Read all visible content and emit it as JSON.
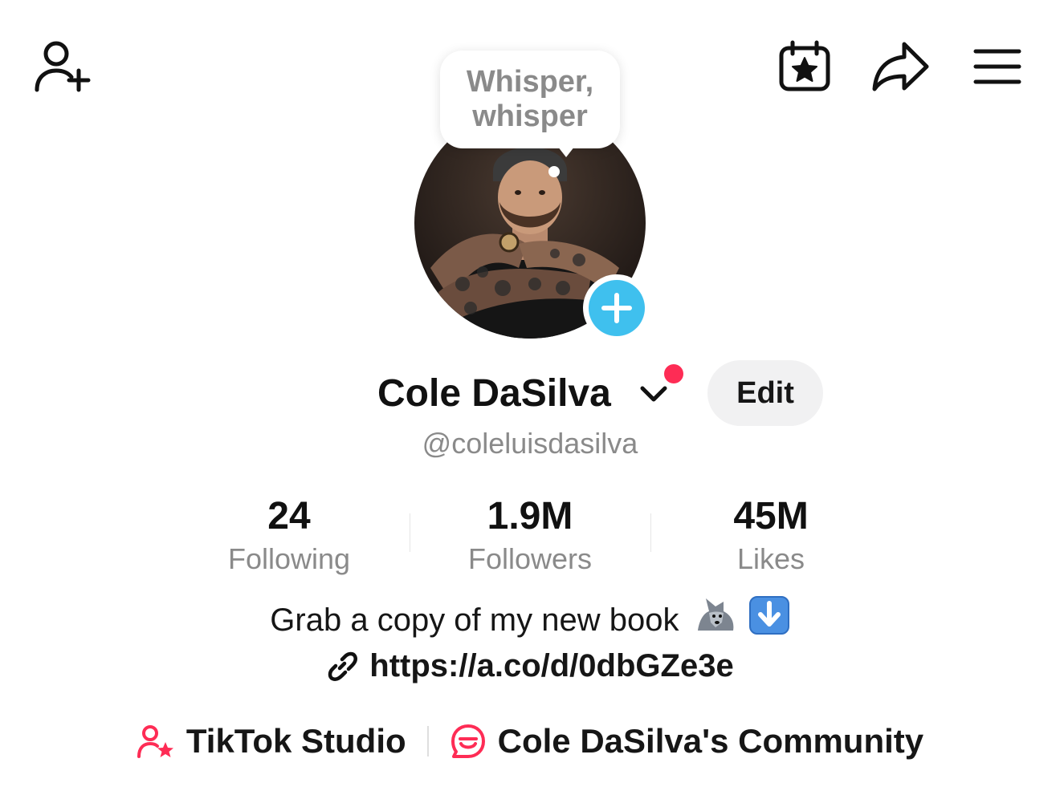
{
  "header": {
    "left_icon": "add-friend-icon",
    "right_icons": [
      "calendar-star-icon",
      "share-arrow-icon",
      "menu-icon"
    ]
  },
  "tooltip": {
    "text": "Whisper, whisper"
  },
  "profile": {
    "name": "Cole DaSilva",
    "handle": "@coleluisdasilva",
    "edit_label": "Edit",
    "accent_color": "#fe2c55",
    "add_color": "#3fc0ee"
  },
  "stats": [
    {
      "value": "24",
      "label": "Following"
    },
    {
      "value": "1.9M",
      "label": "Followers"
    },
    {
      "value": "45M",
      "label": "Likes"
    }
  ],
  "bio": {
    "text": "Grab a copy of my new book",
    "emojis": [
      "wolf-emoji",
      "down-arrow-emoji"
    ],
    "link": "https://a.co/d/0dbGZe3e"
  },
  "bottom_links": [
    {
      "label": "TikTok Studio",
      "icon": "creator-star-icon"
    },
    {
      "label": "Cole DaSilva's Community",
      "icon": "community-chat-icon"
    }
  ]
}
